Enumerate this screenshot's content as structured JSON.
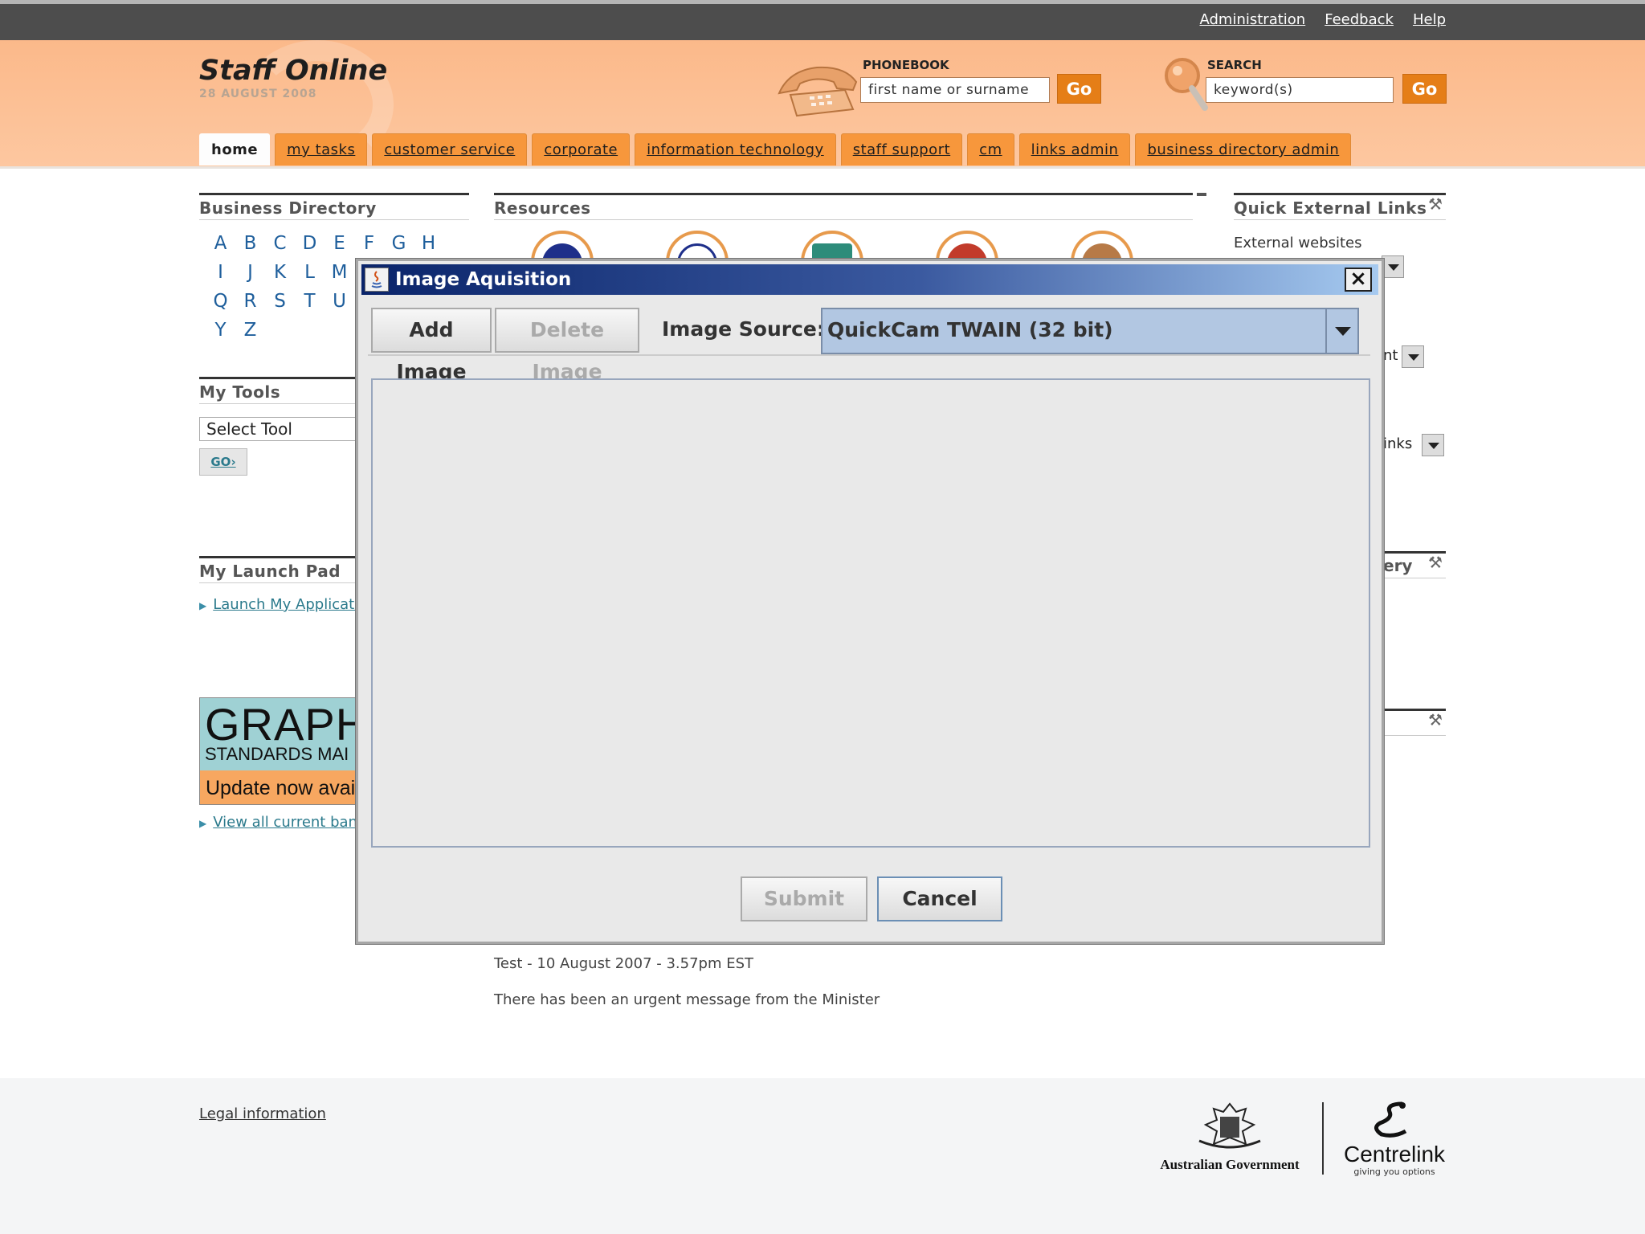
{
  "top_links": [
    "Administration",
    "Feedback",
    "Help"
  ],
  "header": {
    "title": "Staff Online",
    "date": "28 AUGUST 2008",
    "phonebook_label": "PHONEBOOK",
    "phonebook_placeholder": "first name or surname",
    "phonebook_go": "Go",
    "search_label": "SEARCH",
    "search_value": "keyword(s)",
    "search_go": "Go"
  },
  "nav_tabs": [
    {
      "label": "home",
      "active": true
    },
    {
      "label": "my tasks"
    },
    {
      "label": "customer service"
    },
    {
      "label": "corporate"
    },
    {
      "label": "information technology"
    },
    {
      "label": "staff support"
    },
    {
      "label": "cm"
    },
    {
      "label": "links admin"
    },
    {
      "label": "business directory admin"
    }
  ],
  "business_directory": {
    "title": "Business Directory",
    "rows": [
      "A B C D E F G H",
      "I J K L M",
      "Q R S T U",
      "Y Z"
    ]
  },
  "my_tools": {
    "title": "My Tools",
    "select_value": "Select Tool",
    "go_label": "GO›"
  },
  "launch_pad": {
    "title": "My Launch Pad",
    "link": "Launch My Applicatic"
  },
  "banner": {
    "title": "GRAPH",
    "subtitle": "STANDARDS MAI",
    "update": "Update now avai",
    "view_all": "View all current banr"
  },
  "resources": {
    "title": "Resources",
    "collapse_symbol": "-"
  },
  "quick_links": {
    "title": "Quick External Links",
    "external_label": "External websites",
    "peek1": "nt",
    "peek2": "inks",
    "peek3": "ery"
  },
  "news": {
    "item1": "Test - 10 August 2007 - 3.57pm EST",
    "item2": "There has been an urgent message from the Minister"
  },
  "footer": {
    "legal": "Legal information",
    "govt": "Australian Government",
    "centrelink": "Centrelink",
    "centrelink_tag": "giving you options"
  },
  "dialog": {
    "title": "Image Aquisition",
    "close_symbol": "×",
    "add_image": "Add Image",
    "delete_image": "Delete Image",
    "source_label": "Image Source:",
    "source_value": "QuickCam TWAIN (32 bit)",
    "submit": "Submit",
    "cancel": "Cancel"
  },
  "colors": {
    "accent": "#f7973c",
    "header_bg": "#fbb98a",
    "dialog_title": "#0a246a",
    "link": "#2b7a8c"
  }
}
